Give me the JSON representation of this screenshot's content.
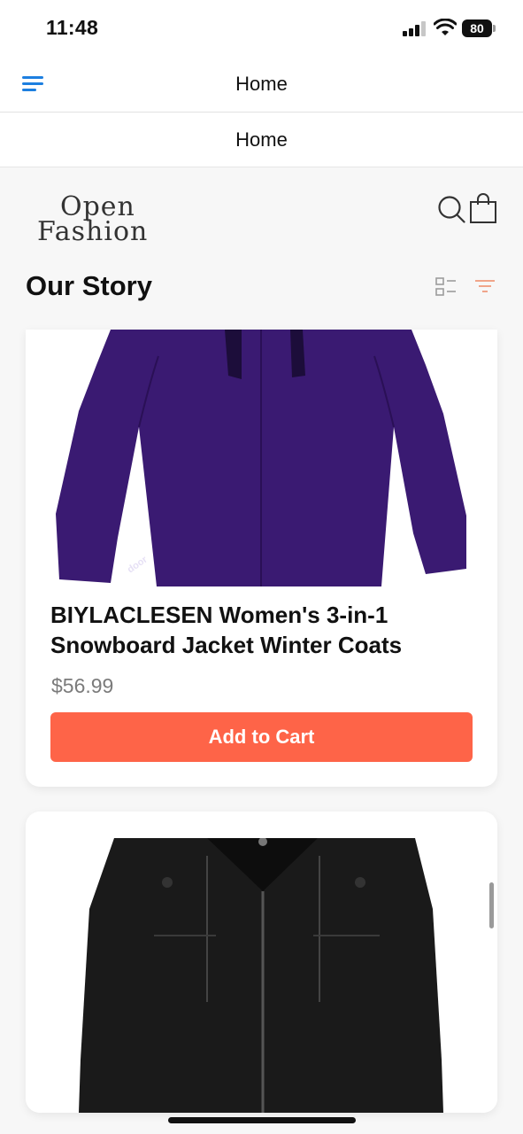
{
  "status_bar": {
    "time": "11:48",
    "battery": "80"
  },
  "nav": {
    "title": "Home"
  },
  "sub_header": {
    "title": "Home"
  },
  "brand": {
    "line1": "Open",
    "line2": "Fashion"
  },
  "section": {
    "title": "Our Story"
  },
  "products": [
    {
      "name": "BIYLACLESEN Women's 3-in-1 Snowboard Jacket Winter Coats",
      "price": "$56.99",
      "button": "Add to Cart",
      "image_color": "#3a1a72"
    },
    {
      "image_color": "#1a1a1a"
    }
  ],
  "colors": {
    "accent": "#fe6448",
    "menu_icon": "#1d7fe0",
    "filter_icon": "#f0a58a"
  }
}
